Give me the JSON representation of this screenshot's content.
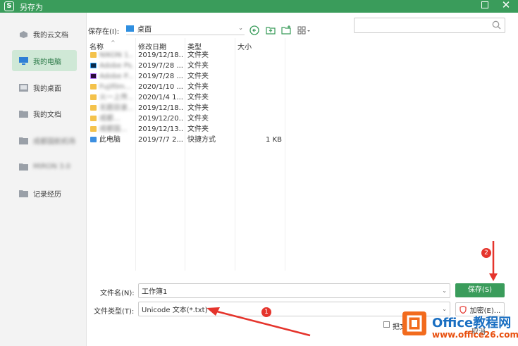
{
  "window": {
    "app_glyph": "S",
    "title": "另存为"
  },
  "sidebar": {
    "items": [
      {
        "label": "我的云文档",
        "icon": "cloud-icon"
      },
      {
        "label": "我的电脑",
        "icon": "computer-icon",
        "active": true
      },
      {
        "label": "我的桌面",
        "icon": "desktop-icon"
      },
      {
        "label": "我的文档",
        "icon": "folder-icon"
      },
      {
        "label": "成都国航机场",
        "icon": "folder-icon",
        "obscured": true
      },
      {
        "label": "MIRON 3.0",
        "icon": "folder-icon",
        "obscured": true
      },
      {
        "label": "记录经历",
        "icon": "folder-icon"
      }
    ]
  },
  "location": {
    "label": "保存在(I):",
    "value": "桌面"
  },
  "search": {
    "placeholder": ""
  },
  "columns": [
    "名称",
    "修改日期",
    "类型",
    "大小"
  ],
  "files": [
    {
      "name": "NIKON 1...",
      "date": "2019/12/18...",
      "type": "文件夹",
      "size": "",
      "icon": "folder-icon",
      "obscured": true
    },
    {
      "name": "Adobe Ps...",
      "date": "2019/7/28 ...",
      "type": "文件夹",
      "size": "",
      "icon": "ps-icon",
      "obscured": true
    },
    {
      "name": "Adobe P...",
      "date": "2019/7/28 ...",
      "type": "文件夹",
      "size": "",
      "icon": "pr-icon",
      "obscured": true
    },
    {
      "name": "Fujifilm...",
      "date": "2020/1/10 ...",
      "type": "文件夹",
      "size": "",
      "icon": "folder-icon",
      "obscured": true
    },
    {
      "name": "火一上传...",
      "date": "2020/1/4 1...",
      "type": "文件夹",
      "size": "",
      "icon": "folder-icon",
      "obscured": true
    },
    {
      "name": "无题目录...",
      "date": "2019/12/18...",
      "type": "文件夹",
      "size": "",
      "icon": "folder-icon",
      "obscured": true
    },
    {
      "name": "成都...",
      "date": "2019/12/20...",
      "type": "文件夹",
      "size": "",
      "icon": "folder-icon",
      "obscured": true
    },
    {
      "name": "成都国...",
      "date": "2019/12/13...",
      "type": "文件夹",
      "size": "",
      "icon": "folder-icon",
      "obscured": true
    },
    {
      "name": "此电脑",
      "date": "2019/7/7 2...",
      "type": "快捷方式",
      "size": "1 KB",
      "icon": "pc-shortcut-icon",
      "obscured": false
    }
  ],
  "filename": {
    "label": "文件名(N):",
    "value": "工作簿1"
  },
  "filetype": {
    "label": "文件类型(T):",
    "value": "Unicode 文本(*.txt)"
  },
  "buttons": {
    "save": "保存(S)",
    "encrypt": "加密(E)...",
    "cancel": "取消"
  },
  "checkbox": {
    "label": "把文"
  },
  "annotations": {
    "badge1": "1",
    "badge2": "2",
    "color": "#e5342c"
  },
  "watermark": {
    "title": "Office教程网",
    "url": "www.office26.com"
  },
  "colors": {
    "accent": "#3a9c5b",
    "active_bg": "#cfe8d6",
    "folder": "#f4c24b"
  }
}
